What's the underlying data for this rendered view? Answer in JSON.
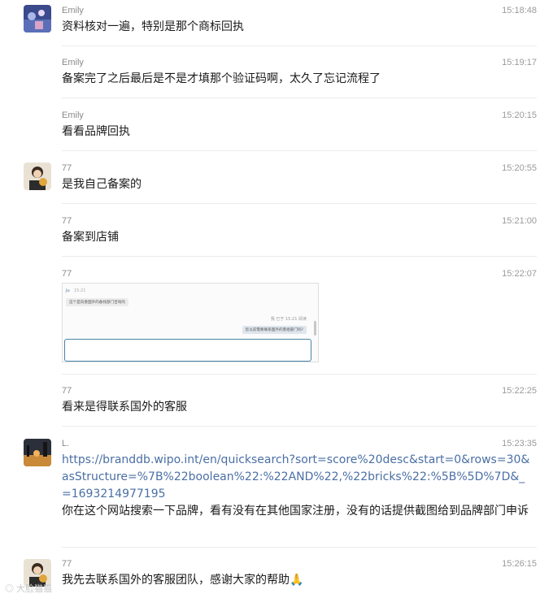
{
  "messages": [
    {
      "name": "Emily",
      "time": "15:18:48",
      "text": "资料核对一遍，特别是那个商标回执"
    },
    {
      "name": "Emily",
      "time": "15:19:17",
      "text": "备案完了之后最后是不是才填那个验证码啊，太久了忘记流程了"
    },
    {
      "name": "Emily",
      "time": "15:20:15",
      "text": "看看品牌回执"
    },
    {
      "name": "77",
      "time": "15:20:55",
      "text": "是我自己备案的"
    },
    {
      "name": "77",
      "time": "15:21:00",
      "text": "备案到店铺"
    },
    {
      "name": "77",
      "time": "15:22:07"
    },
    {
      "name": "77",
      "time": "15:22:25",
      "text": "看来是得联系国外的客服"
    },
    {
      "name": "L.",
      "time": "15:23:35",
      "link": "https://branddb.wipo.int/en/quicksearch?sort=score%20desc&start=0&rows=30&asStructure=%7B%22boolean%22:%22AND%22,%22bricks%22:%5B%5D%7D&_=1693214977195",
      "text": "你在这个网站搜索一下品牌，看有没有在其他国家注册，没有的话提供截图给到品牌部门申诉"
    },
    {
      "name": "77",
      "time": "15:26:15",
      "text": "我先去联系国外的客服团队，感谢大家的帮助🙏"
    }
  ],
  "screenshot": {
    "sender_name": "Ju",
    "sender_time": "15:21",
    "left_bubble": "这个是向香国外的备找部门咨询的",
    "right_meta": "我  已于 15:21 阅读",
    "right_bubble": "您以前需要联系国外的客组部门吗?"
  },
  "watermark": "大脸猫猫"
}
